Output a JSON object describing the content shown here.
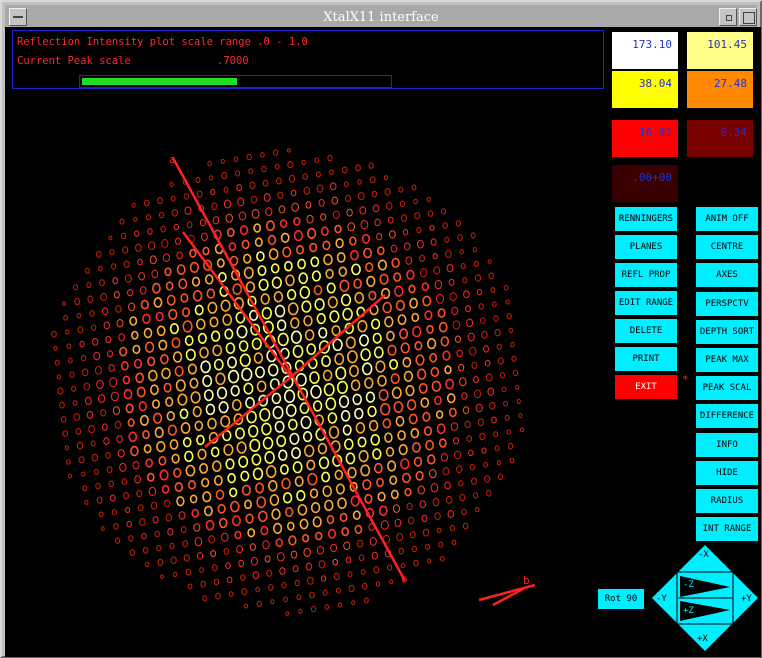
{
  "window": {
    "title": "XtalX11 interface"
  },
  "info": {
    "intensity_line": "Reflection Intensity plot scale range .0 - 1.0",
    "peak_label": "Current Peak scale",
    "peak_value": ".7000",
    "peak_fraction": 0.7
  },
  "scale_swatches": [
    {
      "value": "173.10",
      "color": "#ffffff"
    },
    {
      "value": "101.45",
      "color": "#ffff88"
    },
    {
      "value": "38.04",
      "color": "#ffff00"
    },
    {
      "value": "27.48",
      "color": "#ff8800"
    },
    {
      "value": "16.91",
      "color": "#ff0000"
    },
    {
      "value": "6.34",
      "color": "#7a0000"
    },
    {
      "value": ".00+00",
      "color": "#3a0000"
    }
  ],
  "buttons_left": [
    "RENNINGERS",
    "PLANES",
    "REFL PROP",
    "EDIT RANGE",
    "DELETE",
    "PRINT",
    "EXIT"
  ],
  "buttons_right": [
    "ANIM OFF",
    "CENTRE",
    "AXES",
    "PERSPCTV",
    "DEPTH SORT",
    "PEAK MAX",
    "PEAK SCAL",
    "DIFFERENCE",
    "INFO",
    "HIDE",
    "RADIUS",
    "INT RANGE"
  ],
  "rotation": {
    "rot_label": "Rot 90",
    "minus_x": "-X",
    "plus_x": "+X",
    "minus_y": "-Y",
    "plus_y": "+Y",
    "minus_z": "-Z",
    "plus_z": "+Z"
  },
  "axis_labels": {
    "a": "a",
    "b": "b"
  },
  "colors": {
    "spot_palette": [
      "#ffffaa",
      "#ffff55",
      "#ffaa33",
      "#ff5522",
      "#ff2a2a",
      "#cc2200"
    ],
    "axis": "#ff2020"
  }
}
